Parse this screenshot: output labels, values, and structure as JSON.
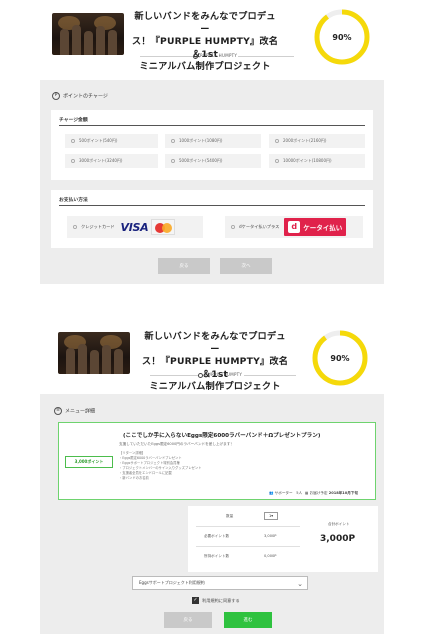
{
  "project": {
    "title_line1": "新しいバンドをみんなでプロデュー",
    "title_line2": "ス！『PURPLE HUMPTY』改名＆1st",
    "title_line3": "ミニアルバム制作プロジェクト",
    "brand": "PURPLE HUMPTY",
    "progress_percent": 90,
    "progress_label": "90%",
    "progress_color": "#f5d90a"
  },
  "charge_page": {
    "section_label": "ポイントのチャージ",
    "section_icon": "p-circle-icon",
    "amount_heading": "チャージ金額",
    "options": [
      "500ポイント(540円)",
      "1000ポイント(1080円)",
      "2000ポイント(2160円)",
      "3000ポイント(3240円)",
      "5000ポイント(5400円)",
      "10000ポイント(10800円)"
    ],
    "payment_heading": "お支払い方法",
    "payment_methods": [
      {
        "label": "クレジットカード",
        "logo": "VISA"
      },
      {
        "label": "dケータイ払いプラス",
        "logo": "ケータイ払い"
      }
    ],
    "back_label": "戻る",
    "next_label": "次へ"
  },
  "menu_page": {
    "section_label": "メニュー詳細",
    "menu_title": "(ここでしか手に入らないEggs限定6000ラバーバンド＋Ωプレゼントプラン)",
    "menu_desc": "支援していただいたEggs限定6000円のラバーバンドを差し上げます！",
    "price_label": "3,000ポイント",
    "rewards": [
      "【リターン詳細】",
      "・Eggs限定6000ラバーバンドプレゼント",
      "・Eggsサポートプロジェクト特別会員権",
      "・プロジェクトメンバーのサイン入りグッズプレゼント",
      "・支援者全員をエンドロールに記載",
      "・新バンドのお名前"
    ],
    "supporters": "サポーター　5人",
    "delivery_label": "お届け予定",
    "delivery_date": "2018年10月下旬",
    "qty_label": "数量",
    "qty_value": "1",
    "required_label": "必要ポイント数",
    "required_value": "3,000P",
    "held_label": "所持ポイント数",
    "held_value": "0,000P",
    "total_label": "合計ポイント",
    "total_value": "3,000P",
    "select_text": "Eggsサポートプロジェクト利用規約",
    "agree_label": "利用規約に同意する",
    "back_label": "戻る",
    "next_label": "進む"
  }
}
